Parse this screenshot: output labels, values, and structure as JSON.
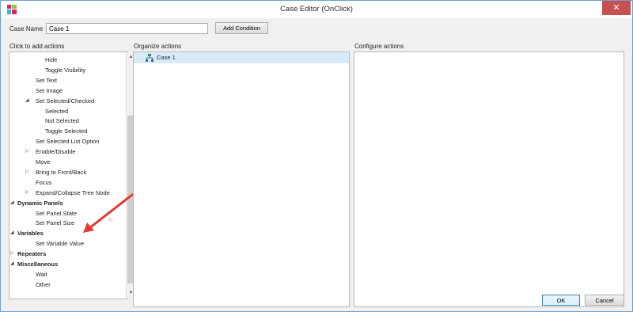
{
  "window": {
    "title": "Case Editor (OnClick)",
    "close_glyph": "✕",
    "app_icon": "app-logo-icon"
  },
  "case_name": {
    "label": "Case Name",
    "value": "Case 1"
  },
  "toolbar": {
    "add_condition_label": "Add Condition"
  },
  "panels": {
    "actions_header": "Click to add actions",
    "organize_header": "Organize actions",
    "configure_header": "Configure actions"
  },
  "actions_tree": [
    {
      "label": "Hide",
      "level": 3,
      "toggle": "none",
      "bold": false
    },
    {
      "label": "Toggle Visibility",
      "level": 3,
      "toggle": "none",
      "bold": false
    },
    {
      "label": "Set Text",
      "level": 2,
      "toggle": "none",
      "bold": false
    },
    {
      "label": "Set Image",
      "level": 2,
      "toggle": "none",
      "bold": false
    },
    {
      "label": "Set Selected/Checked",
      "level": 2,
      "toggle": "expanded",
      "bold": false
    },
    {
      "label": "Selected",
      "level": 3,
      "toggle": "none",
      "bold": false
    },
    {
      "label": "Not Selected",
      "level": 3,
      "toggle": "none",
      "bold": false
    },
    {
      "label": "Toggle Selected",
      "level": 3,
      "toggle": "none",
      "bold": false
    },
    {
      "label": "Set Selected List Option",
      "level": 2,
      "toggle": "none",
      "bold": false
    },
    {
      "label": "Enable/Disable",
      "level": 2,
      "toggle": "collapsed",
      "bold": false
    },
    {
      "label": "Move",
      "level": 2,
      "toggle": "none",
      "bold": false
    },
    {
      "label": "Bring to Front/Back",
      "level": 2,
      "toggle": "collapsed",
      "bold": false
    },
    {
      "label": "Focus",
      "level": 2,
      "toggle": "none",
      "bold": false
    },
    {
      "label": "Expand/Collapse Tree Node",
      "level": 2,
      "toggle": "collapsed",
      "bold": false
    },
    {
      "label": "Dynamic Panels",
      "level": 1,
      "toggle": "expanded",
      "bold": true
    },
    {
      "label": "Set Panel State",
      "level": 2,
      "toggle": "none",
      "bold": false
    },
    {
      "label": "Set Panel Size",
      "level": 2,
      "toggle": "none",
      "bold": false
    },
    {
      "label": "Variables",
      "level": 1,
      "toggle": "expanded",
      "bold": true
    },
    {
      "label": "Set Variable Value",
      "level": 2,
      "toggle": "none",
      "bold": false
    },
    {
      "label": "Repeaters",
      "level": 1,
      "toggle": "collapsed",
      "bold": true
    },
    {
      "label": "Miscellaneous",
      "level": 1,
      "toggle": "expanded",
      "bold": true
    },
    {
      "label": "Wait",
      "level": 2,
      "toggle": "none",
      "bold": false
    },
    {
      "label": "Other",
      "level": 2,
      "toggle": "none",
      "bold": false
    }
  ],
  "organize": {
    "cases": [
      {
        "label": "Case 1",
        "icon": "case-tree-icon",
        "selected": true
      }
    ]
  },
  "annotation": {
    "arrow_color": "#e53935",
    "arrow_icon": "annotation-arrow-icon"
  },
  "footer": {
    "ok_label": "OK",
    "cancel_label": "Cancel"
  },
  "colors": {
    "selection": "#d9ebf9",
    "close_button": "#c75050",
    "window_border": "#6f9fcd",
    "ok_border": "#3c7fb1"
  }
}
